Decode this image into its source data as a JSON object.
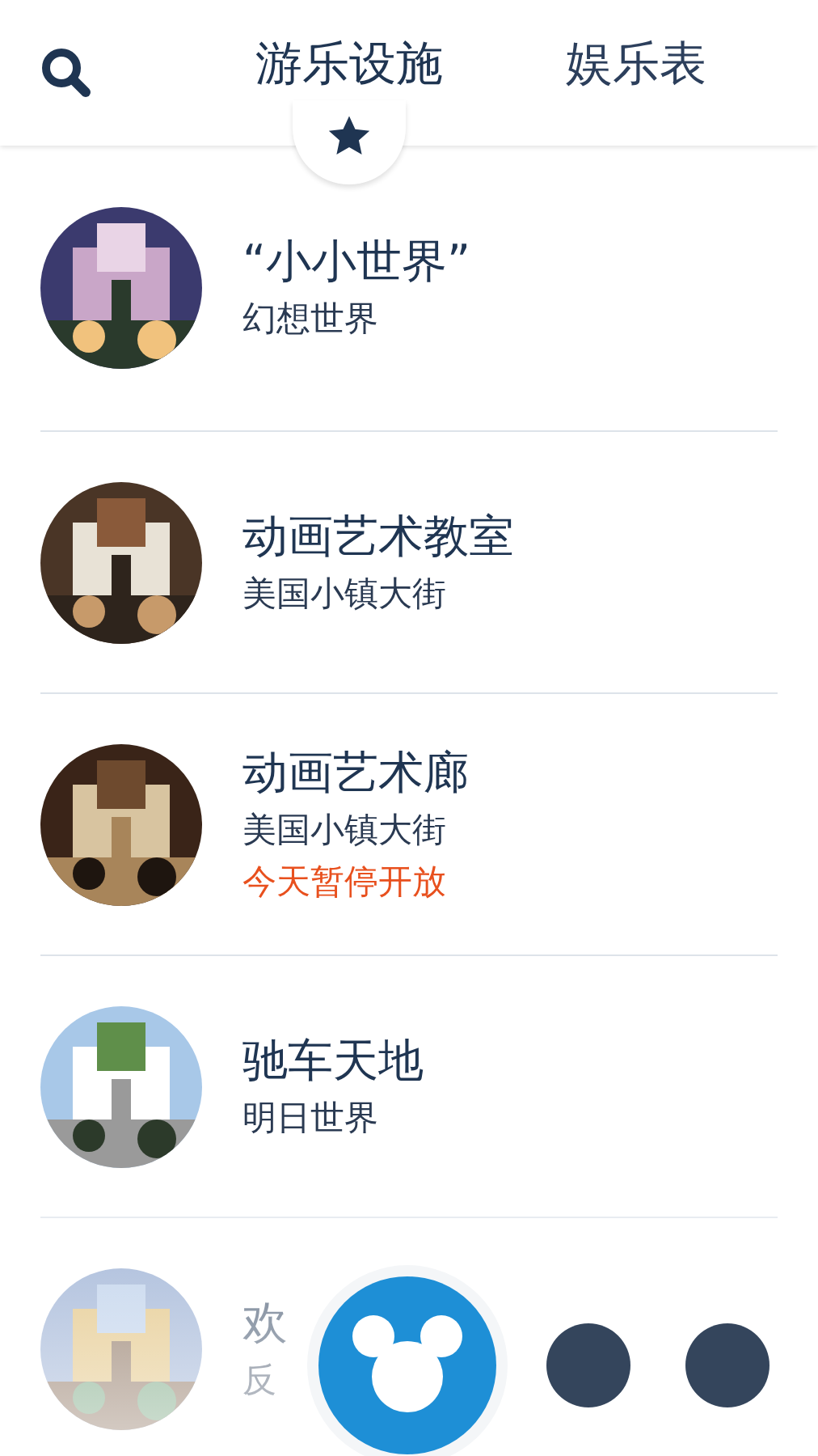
{
  "tabs": [
    {
      "label": "游乐设施",
      "selected": true
    },
    {
      "label": "娱乐表",
      "selected": false
    }
  ],
  "items": [
    {
      "title": "“小小世界”",
      "subtitle": "幻想世界"
    },
    {
      "title": "动画艺术教室",
      "subtitle": "美国小镇大街"
    },
    {
      "title": "动画艺术廊",
      "subtitle": "美国小镇大街",
      "status": "今天暂停开放"
    },
    {
      "title": "驰车天地",
      "subtitle": "明日世界"
    },
    {
      "title": "欢",
      "subtitle": "反"
    }
  ]
}
